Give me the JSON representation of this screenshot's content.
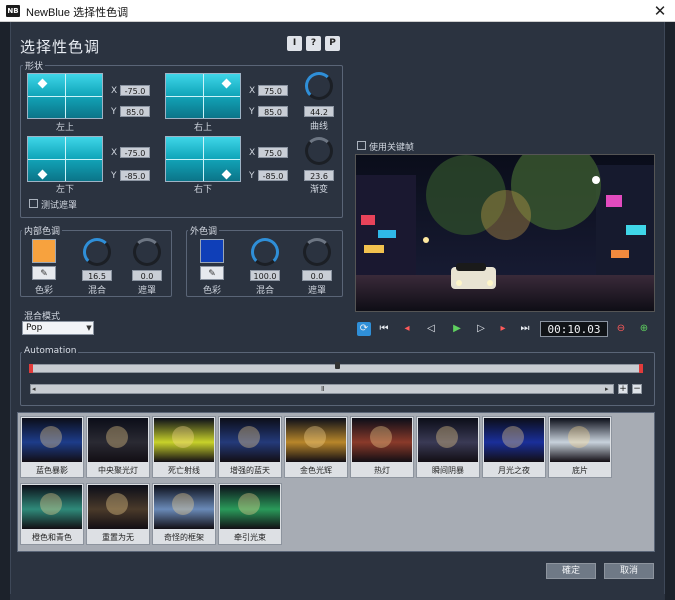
{
  "window": {
    "app_icon": "NB",
    "title": "NewBlue 选择性色调",
    "close": "✕"
  },
  "header": {
    "title": "选择性色调",
    "buttons": [
      "I",
      "?",
      "P"
    ]
  },
  "shape": {
    "label": "形状",
    "boxes": [
      {
        "caption": "左上",
        "x": "-75.0",
        "y": "85.0"
      },
      {
        "caption": "右上",
        "x": "75.0",
        "y": "85.0"
      },
      {
        "caption": "左下",
        "x": "-75.0",
        "y": "-85.0"
      },
      {
        "caption": "右下",
        "x": "75.0",
        "y": "-85.0"
      }
    ],
    "x_label": "X",
    "y_label": "Y",
    "curve": {
      "value": "44.2",
      "label": "曲线"
    },
    "gradient": {
      "value": "23.6",
      "label": "渐变"
    },
    "test_mask": "测试遮罩"
  },
  "inner": {
    "label": "内部色调",
    "color": "#f7a23e",
    "color_label": "色彩",
    "mix": {
      "value": "16.5",
      "label": "混合"
    },
    "mask": {
      "value": "0.0",
      "label": "遮罩"
    }
  },
  "outer": {
    "label": "外色调",
    "color": "#0f3fb8",
    "color_label": "色彩",
    "mix": {
      "value": "100.0",
      "label": "混合"
    },
    "mask": {
      "value": "0.0",
      "label": "遮罩"
    }
  },
  "blend": {
    "label": "混合模式",
    "value": "Pop"
  },
  "preview": {
    "keyframe_label": "使用关键帧"
  },
  "transport": {
    "timecode": "00:10.03"
  },
  "automation": {
    "label": "Automation"
  },
  "presets": [
    "蓝色暴影",
    "中央聚光灯",
    "死亡射线",
    "增强的蓝天",
    "金色光辉",
    "热灯",
    "瞬间阴暴",
    "月光之夜",
    "底片",
    "橙色和青色",
    "重置为无",
    "奇怪的框架",
    "牵引光束"
  ],
  "footer": {
    "ok": "確定",
    "cancel": "取消"
  },
  "colors": {
    "accent": "#2f8fd8",
    "background": "#2b3340",
    "inner_swatch": "#f7a23e",
    "outer_swatch": "#0f3fb8"
  }
}
